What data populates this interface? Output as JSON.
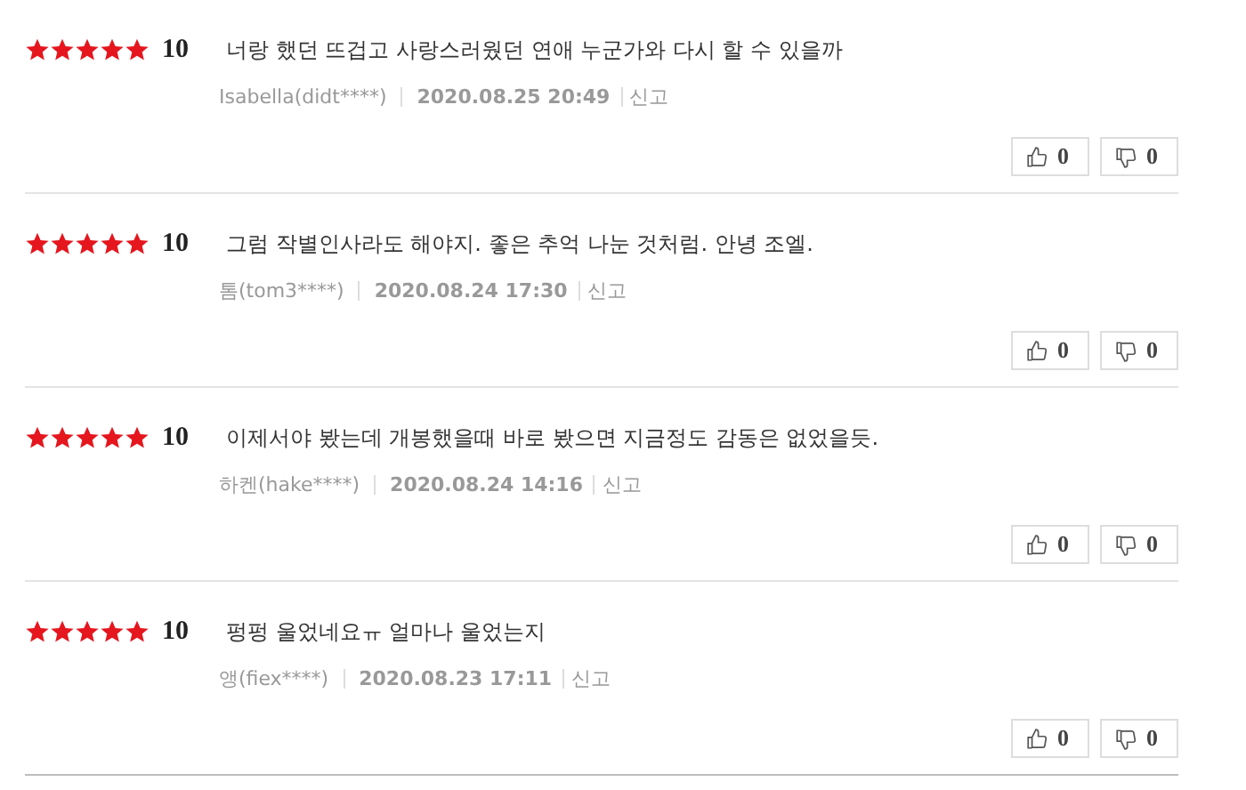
{
  "reviews": [
    {
      "stars": 5,
      "score": "10",
      "text": "너랑 했던 뜨겁고 사랑스러웠던 연애 누군가와 다시 할 수 있을까",
      "author": "Isabella(didt****)",
      "date": "2020.08.25 20:49",
      "report": "신고",
      "likes": "0",
      "dislikes": "0"
    },
    {
      "stars": 5,
      "score": "10",
      "text": "그럼 작별인사라도 해야지. 좋은 추억 나눈 것처럼. 안녕 조엘.",
      "author": "톰(tom3****)",
      "date": "2020.08.24 17:30",
      "report": "신고",
      "likes": "0",
      "dislikes": "0"
    },
    {
      "stars": 5,
      "score": "10",
      "text": "이제서야 봤는데 개봉했을때 바로 봤으면 지금정도 감동은 없었을듯.",
      "author": "하켄(hake****)",
      "date": "2020.08.24 14:16",
      "report": "신고",
      "likes": "0",
      "dislikes": "0"
    },
    {
      "stars": 5,
      "score": "10",
      "text": "펑펑 울었네요ㅠ 얼마나 울었는지",
      "author": "앵(fiex****)",
      "date": "2020.08.23 17:11",
      "report": "신고",
      "likes": "0",
      "dislikes": "0"
    }
  ]
}
